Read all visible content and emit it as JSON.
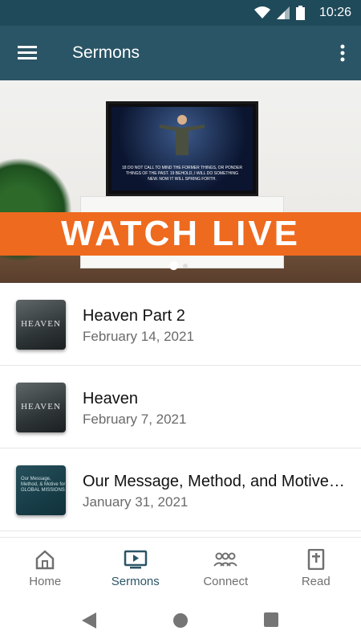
{
  "status": {
    "time": "10:26"
  },
  "appbar": {
    "title": "Sermons"
  },
  "hero": {
    "banner_text": "WATCH LIVE",
    "tv_caption": "18 DO NOT CALL TO MIND THE FORMER THINGS, OR PONDER THINGS OF THE PAST. 19 BEHOLD, I WILL DO SOMETHING NEW. NOW IT WILL SPRING FORTH."
  },
  "sermons": [
    {
      "title": "Heaven Part 2",
      "date": "February 14, 2021",
      "thumb_text": "HEAVEN"
    },
    {
      "title": "Heaven",
      "date": "February 7, 2021",
      "thumb_text": "HEAVEN"
    },
    {
      "title": "Our Message, Method, and Motive for Global Missions",
      "date": "January 31, 2021",
      "thumb_text": "Our Message, Method, & Motive for GLOBAL MISSIONS"
    }
  ],
  "nav": [
    {
      "label": "Home",
      "icon": "home-icon"
    },
    {
      "label": "Sermons",
      "icon": "tv-play-icon"
    },
    {
      "label": "Connect",
      "icon": "people-icon"
    },
    {
      "label": "Read",
      "icon": "bible-icon"
    }
  ],
  "colors": {
    "header": "#2a5566",
    "statusbar": "#1f4a59",
    "banner": "#ee6a1f",
    "active_nav": "#2a5566"
  }
}
